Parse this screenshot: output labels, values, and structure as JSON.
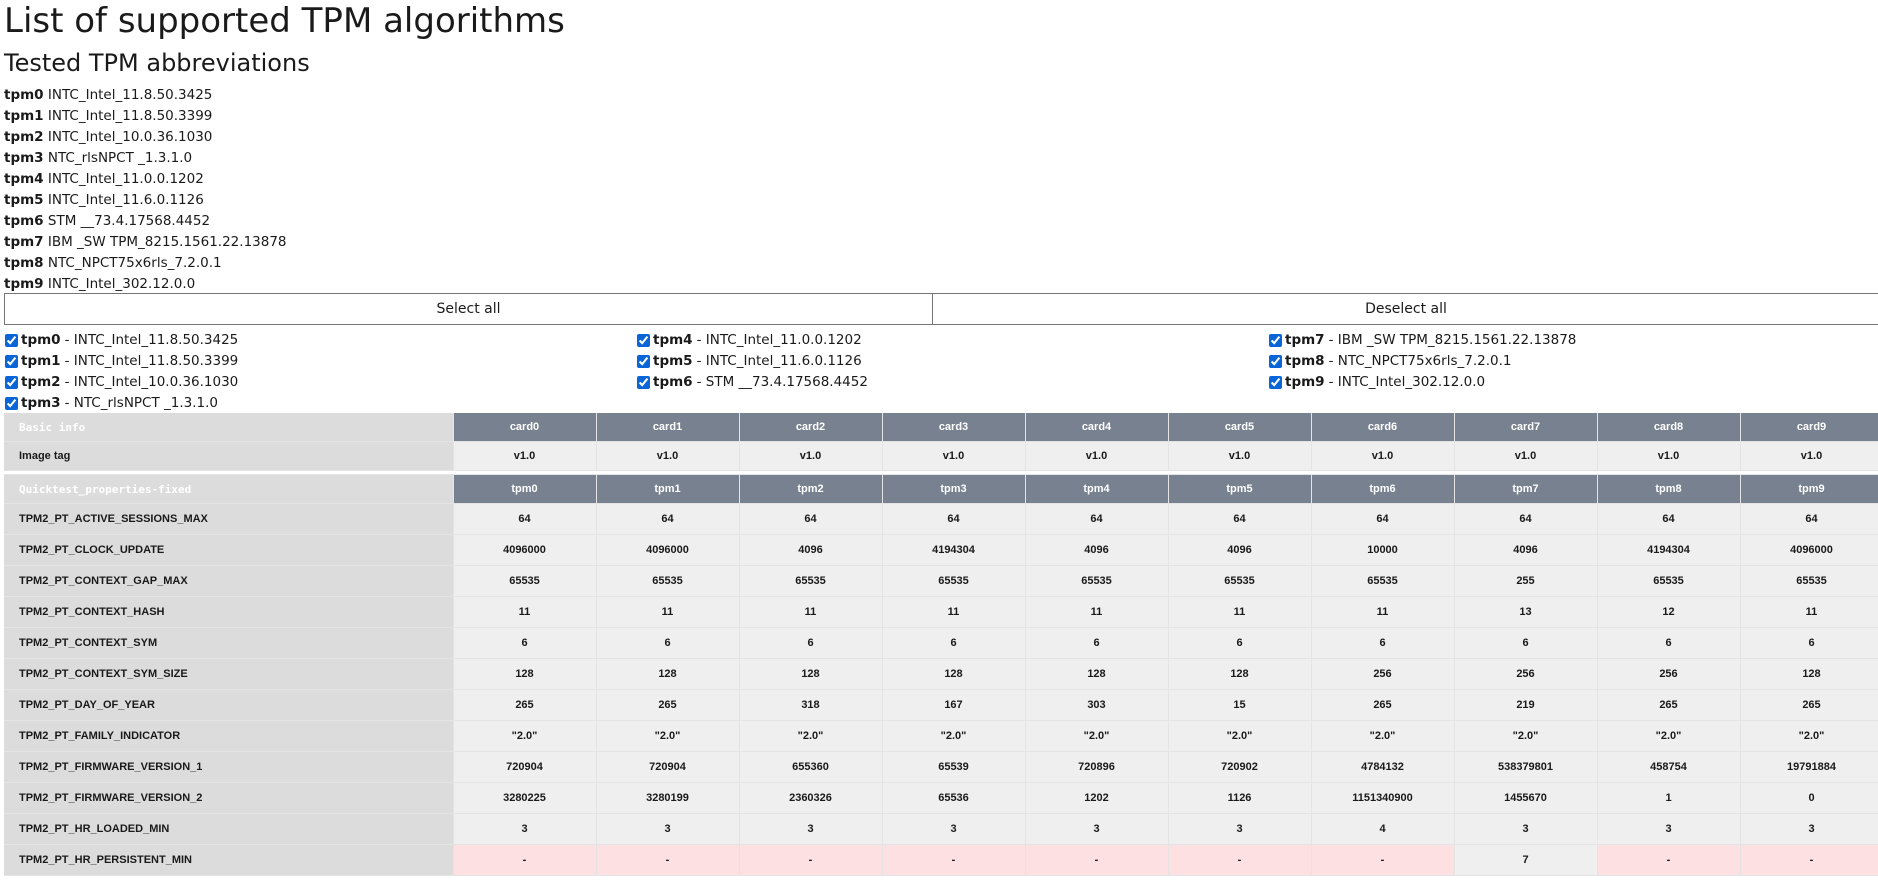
{
  "title": "List of supported TPM algorithms",
  "subtitle": "Tested TPM abbreviations",
  "abbreviations": [
    {
      "id": "tpm0",
      "name": "INTC_Intel_11.8.50.3425"
    },
    {
      "id": "tpm1",
      "name": "INTC_Intel_11.8.50.3399"
    },
    {
      "id": "tpm2",
      "name": "INTC_Intel_10.0.36.1030"
    },
    {
      "id": "tpm3",
      "name": "NTC_rlsNPCT _1.3.1.0"
    },
    {
      "id": "tpm4",
      "name": "INTC_Intel_11.0.0.1202"
    },
    {
      "id": "tpm5",
      "name": "INTC_Intel_11.6.0.1126"
    },
    {
      "id": "tpm6",
      "name": "STM __73.4.17568.4452"
    },
    {
      "id": "tpm7",
      "name": "IBM _SW TPM_8215.1561.22.13878"
    },
    {
      "id": "tpm8",
      "name": "NTC_NPCT75x6rls_7.2.0.1"
    },
    {
      "id": "tpm9",
      "name": "INTC_Intel_302.12.0.0"
    }
  ],
  "buttons": {
    "select_all": "Select all",
    "deselect_all": "Deselect all"
  },
  "checkbox_separator": "- ",
  "table": {
    "basic_info_label": "Basic info",
    "cards": [
      "card0",
      "card1",
      "card2",
      "card3",
      "card4",
      "card5",
      "card6",
      "card7",
      "card8",
      "card9"
    ],
    "image_tag_label": "Image tag",
    "image_tags": [
      "v1.0",
      "v1.0",
      "v1.0",
      "v1.0",
      "v1.0",
      "v1.0",
      "v1.0",
      "v1.0",
      "v1.0",
      "v1.0"
    ],
    "section_label": "Quicktest_properties-fixed",
    "tpms": [
      "tpm0",
      "tpm1",
      "tpm2",
      "tpm3",
      "tpm4",
      "tpm5",
      "tpm6",
      "tpm7",
      "tpm8",
      "tpm9"
    ],
    "missing_color": "#fde0e1",
    "rows": [
      {
        "name": "TPM2_PT_ACTIVE_SESSIONS_MAX",
        "values": [
          "64",
          "64",
          "64",
          "64",
          "64",
          "64",
          "64",
          "64",
          "64",
          "64"
        ]
      },
      {
        "name": "TPM2_PT_CLOCK_UPDATE",
        "values": [
          "4096000",
          "4096000",
          "4096",
          "4194304",
          "4096",
          "4096",
          "10000",
          "4096",
          "4194304",
          "4096000"
        ]
      },
      {
        "name": "TPM2_PT_CONTEXT_GAP_MAX",
        "values": [
          "65535",
          "65535",
          "65535",
          "65535",
          "65535",
          "65535",
          "65535",
          "255",
          "65535",
          "65535"
        ]
      },
      {
        "name": "TPM2_PT_CONTEXT_HASH",
        "values": [
          "11",
          "11",
          "11",
          "11",
          "11",
          "11",
          "11",
          "13",
          "12",
          "11"
        ]
      },
      {
        "name": "TPM2_PT_CONTEXT_SYM",
        "values": [
          "6",
          "6",
          "6",
          "6",
          "6",
          "6",
          "6",
          "6",
          "6",
          "6"
        ]
      },
      {
        "name": "TPM2_PT_CONTEXT_SYM_SIZE",
        "values": [
          "128",
          "128",
          "128",
          "128",
          "128",
          "128",
          "256",
          "256",
          "256",
          "128"
        ]
      },
      {
        "name": "TPM2_PT_DAY_OF_YEAR",
        "values": [
          "265",
          "265",
          "318",
          "167",
          "303",
          "15",
          "265",
          "219",
          "265",
          "265"
        ]
      },
      {
        "name": "TPM2_PT_FAMILY_INDICATOR",
        "values": [
          "\"2.0\"",
          "\"2.0\"",
          "\"2.0\"",
          "\"2.0\"",
          "\"2.0\"",
          "\"2.0\"",
          "\"2.0\"",
          "\"2.0\"",
          "\"2.0\"",
          "\"2.0\""
        ]
      },
      {
        "name": "TPM2_PT_FIRMWARE_VERSION_1",
        "values": [
          "720904",
          "720904",
          "655360",
          "65539",
          "720896",
          "720902",
          "4784132",
          "538379801",
          "458754",
          "19791884"
        ]
      },
      {
        "name": "TPM2_PT_FIRMWARE_VERSION_2",
        "values": [
          "3280225",
          "3280199",
          "2360326",
          "65536",
          "1202",
          "1126",
          "1151340900",
          "1455670",
          "1",
          "0"
        ]
      },
      {
        "name": "TPM2_PT_HR_LOADED_MIN",
        "values": [
          "3",
          "3",
          "3",
          "3",
          "3",
          "3",
          "4",
          "3",
          "3",
          "3"
        ]
      },
      {
        "name": "TPM2_PT_HR_PERSISTENT_MIN",
        "values": [
          "-",
          "-",
          "-",
          "-",
          "-",
          "-",
          "-",
          "7",
          "-",
          "-"
        ]
      }
    ]
  }
}
